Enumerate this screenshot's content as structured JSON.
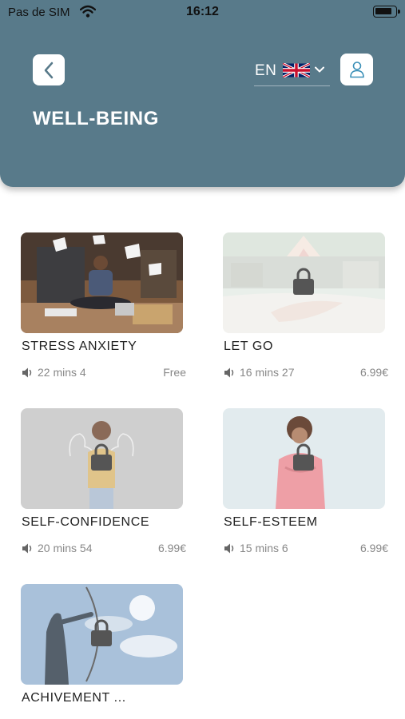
{
  "status_bar": {
    "carrier": "Pas de SIM",
    "time": "16:12"
  },
  "header": {
    "language": "EN",
    "title": "WELL-BEING"
  },
  "colors": {
    "header": "#587a8a",
    "accent": "#3a8fb7"
  },
  "icons": {
    "back": "chevron-left-icon",
    "flag": "uk-flag-icon",
    "dropdown": "chevron-down-icon",
    "profile": "user-icon",
    "audio": "speaker-icon",
    "locked": "lock-icon"
  },
  "items": [
    {
      "title": "STRESS ANXIETY",
      "duration": "22 mins 4",
      "price": "Free",
      "locked": false
    },
    {
      "title": "LET GO",
      "duration": "16 mins 27",
      "price": "6.99€",
      "locked": true
    },
    {
      "title": "SELF-CONFIDENCE",
      "duration": "20 mins 54",
      "price": "6.99€",
      "locked": true
    },
    {
      "title": "SELF-ESTEEM",
      "duration": "15 mins 6",
      "price": "6.99€",
      "locked": true
    },
    {
      "title": "ACHIVEMENT ...",
      "locked": true
    }
  ]
}
